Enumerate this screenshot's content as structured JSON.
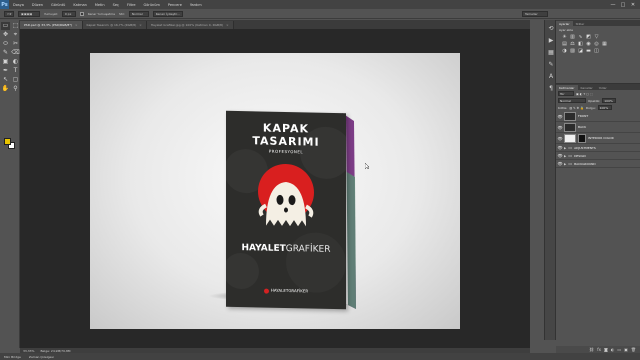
{
  "app": {
    "logo": "Ps"
  },
  "menubar": {
    "items": [
      "Dosya",
      "Düzen",
      "Görüntü",
      "Katman",
      "Metin",
      "Seç",
      "Filtre",
      "Görünüm",
      "Pencere",
      "Yardım"
    ],
    "window_controls": [
      "—",
      "□",
      "✕"
    ]
  },
  "options_bar": {
    "feather_label": "Yumuşat:",
    "feather_value": "0 px",
    "antialias_label": "Kenar Yumuşatma",
    "style_label": "Stil:",
    "style_value": "Normal",
    "refine_label": "Kenarı İyileştir...",
    "workspace": "Temeller"
  },
  "tabs": [
    {
      "label": "PSD.psd @ 33,3% (PSD/RGB/8*)",
      "active": true
    },
    {
      "label": "Kapak Tasarımı @ 16,7% (RGB/8)",
      "active": false
    },
    {
      "label": "Hayalet Grafiker.jpg @ 100% (Katman 0, RGB/8)",
      "active": false
    }
  ],
  "tools": [
    "▭",
    "⬚",
    "✥",
    "⌖",
    "⬭",
    "✂",
    "✎",
    "⌫",
    "▣",
    "◐",
    "✒",
    "T",
    "↖",
    "▢",
    "✋",
    "⚲"
  ],
  "colors": {
    "foreground": "#e8c400",
    "background": "#ffffff",
    "accent_selected": "#5e7594"
  },
  "cover": {
    "title_line1": "KAPAK",
    "title_line2": "TASARIMI",
    "subtitle": "PROFESYONEL",
    "brand_bold": "HAYALET",
    "brand_light": "GRAFİKER",
    "footer_brand": "HAYALETGRAFİKER"
  },
  "status": {
    "zoom": "33,33%",
    "doc_size": "Belge: 24,9M/70,8M"
  },
  "bottom_bar": {
    "items": [
      "Mini Bridge",
      "Zaman Çizelgesi"
    ]
  },
  "dock_icons": [
    "history-icon",
    "actions-icon",
    "swatches-icon",
    "brush-icon",
    "character-icon",
    "paragraph-icon"
  ],
  "adjustments_panel": {
    "tabs": [
      "Ayarlar",
      "Stiller"
    ],
    "title": "Ayar ekle"
  },
  "layers_panel": {
    "tabs": [
      "Katmanlar",
      "Kanallar",
      "Yollar"
    ],
    "kind_value": "Tür",
    "blend_mode": "Normal",
    "opacity_label": "Opaklık:",
    "opacity_value": "100%",
    "lock_label": "Kilitle:",
    "fill_label": "Dolgu:",
    "fill_value": "100%",
    "layers": [
      {
        "name": "FRONT",
        "type": "smart",
        "selected": false
      },
      {
        "name": "BACK",
        "type": "smart",
        "selected": false
      },
      {
        "name": "INTERIOR COLOR",
        "type": "mask",
        "selected": false
      },
      {
        "name": "ADJUSTMENTS",
        "type": "group",
        "selected": false
      },
      {
        "name": "DESIGN",
        "type": "group",
        "selected": false
      },
      {
        "name": "BACKGROUND",
        "type": "group",
        "selected": false
      }
    ],
    "footer_icons": [
      "link-icon",
      "fx-icon",
      "mask-icon",
      "adjustment-icon",
      "folder-icon",
      "new-layer-icon",
      "trash-icon"
    ]
  }
}
